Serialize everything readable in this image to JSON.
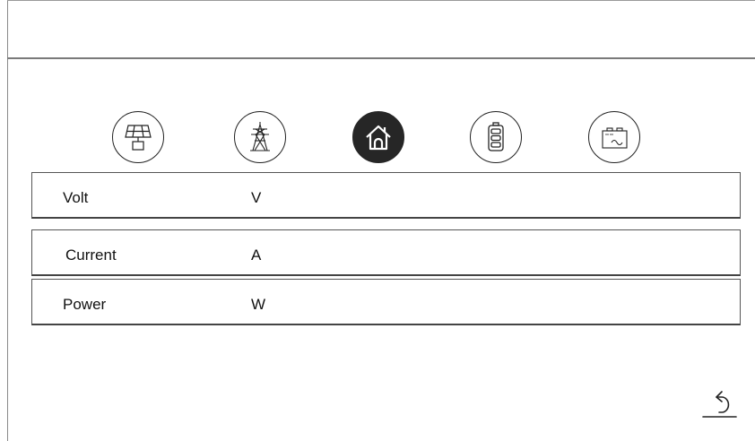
{
  "tabs": [
    {
      "icon": "solar-panel-icon",
      "active": false
    },
    {
      "icon": "power-tower-icon",
      "active": false
    },
    {
      "icon": "home-icon",
      "active": true
    },
    {
      "icon": "battery-icon",
      "active": false
    },
    {
      "icon": "ac-battery-icon",
      "active": false
    }
  ],
  "readings": [
    {
      "label": "Volt",
      "value": "",
      "unit": "V"
    },
    {
      "label": "Current",
      "value": "",
      "unit": "A"
    },
    {
      "label": "Power",
      "value": "",
      "unit": "W"
    }
  ],
  "footer": {
    "back_icon": "back-arrow-icon"
  }
}
